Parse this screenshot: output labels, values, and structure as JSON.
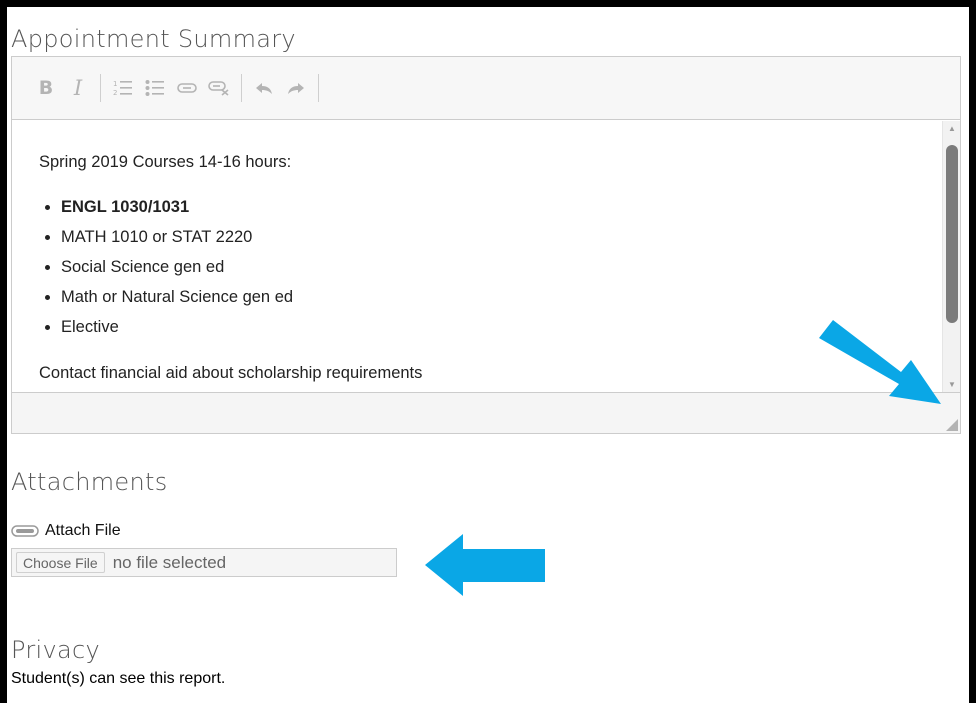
{
  "summary": {
    "title": "Appointment Summary",
    "intro": "Spring 2019 Courses 14-16 hours:",
    "courses": [
      "ENGL 1030/1031",
      "MATH 1010 or STAT 2220",
      "Social Science gen ed",
      "Math or Natural Science gen ed",
      "Elective"
    ],
    "footer_note": "Contact financial aid about scholarship requirements"
  },
  "toolbar": {
    "bold_icon": "B",
    "italic_icon": "I",
    "tools": [
      "bold-icon",
      "italic-icon",
      "ordered-list-icon",
      "unordered-list-icon",
      "link-icon",
      "unlink-icon",
      "undo-icon",
      "redo-icon"
    ]
  },
  "attachments": {
    "title": "Attachments",
    "attach_label": "Attach File",
    "choose_button": "Choose File",
    "no_file_text": "no file selected"
  },
  "privacy": {
    "title": "Privacy",
    "text": "Student(s) can see this report."
  },
  "colors": {
    "arrow": "#0aa7e6",
    "scroll_thumb": "#7b7b7b"
  }
}
